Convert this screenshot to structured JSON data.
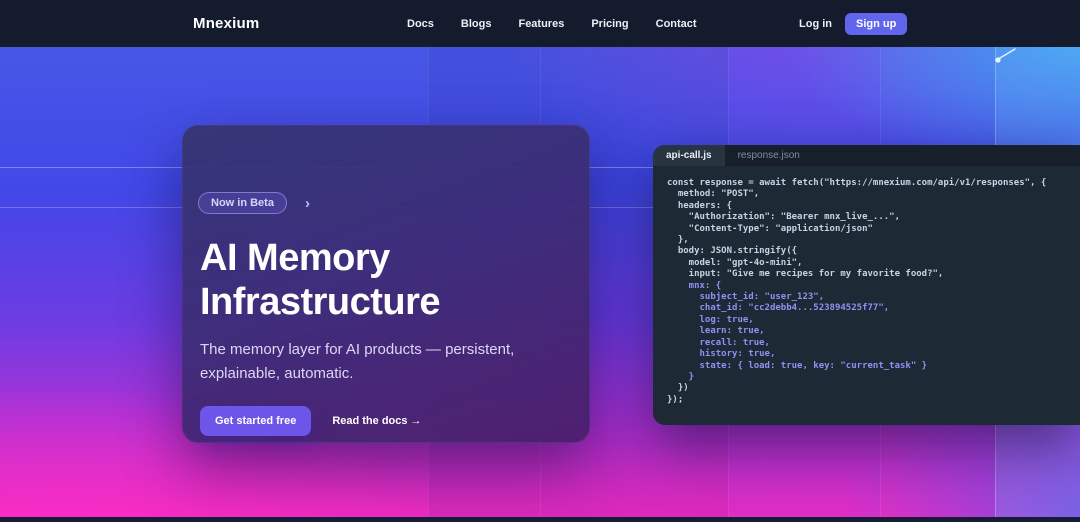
{
  "navbar": {
    "logo": "Mnexium",
    "links": [
      {
        "label": "Docs"
      },
      {
        "label": "Blogs"
      },
      {
        "label": "Features"
      },
      {
        "label": "Pricing"
      },
      {
        "label": "Contact"
      }
    ],
    "login_label": "Log in",
    "signup_label": "Sign up"
  },
  "hero": {
    "badge_label": "Now in Beta",
    "badge_chevron": "›",
    "title": "AI Memory Infrastructure",
    "subtitle": "The memory layer for AI products — persistent, explainable, automatic.",
    "primary_cta": "Get started free",
    "secondary_cta": "Read the docs →"
  },
  "code_panel": {
    "tabs": [
      {
        "label": "api-call.js",
        "active": true
      },
      {
        "label": "response.json",
        "active": false
      }
    ],
    "lines": [
      {
        "text": "const response = await fetch(\"https://mnexium.com/api/v1/responses\", {",
        "tone": "default"
      },
      {
        "text": "  method: \"POST\",",
        "tone": "default"
      },
      {
        "text": "  headers: {",
        "tone": "default"
      },
      {
        "text": "    \"Authorization\": \"Bearer mnx_live_...\",",
        "tone": "default"
      },
      {
        "text": "    \"Content-Type\": \"application/json\"",
        "tone": "default"
      },
      {
        "text": "  },",
        "tone": "default"
      },
      {
        "text": "  body: JSON.stringify({",
        "tone": "default"
      },
      {
        "text": "    model: \"gpt-4o-mini\",",
        "tone": "default"
      },
      {
        "text": "    input: \"Give me recipes for my favorite food?\",",
        "tone": "default"
      },
      {
        "text": "    mnx: {",
        "tone": "accent"
      },
      {
        "text": "      subject_id: \"user_123\",",
        "tone": "accent"
      },
      {
        "text": "      chat_id: \"cc2debb4...523894525f77\",",
        "tone": "accent"
      },
      {
        "text": "      log: true,",
        "tone": "accent"
      },
      {
        "text": "      learn: true,",
        "tone": "accent"
      },
      {
        "text": "      recall: true,",
        "tone": "accent"
      },
      {
        "text": "      history: true,",
        "tone": "accent"
      },
      {
        "text": "      state: { load: true, key: \"current_task\" }",
        "tone": "accent"
      },
      {
        "text": "    }",
        "tone": "accent"
      },
      {
        "text": "  })",
        "tone": "default"
      },
      {
        "text": "});",
        "tone": "default"
      }
    ]
  },
  "colors": {
    "navbar_bg": "#131b2d",
    "signup_purple": "#6165ec",
    "cta_purple": "#6d55ea",
    "code_panel_bg": "#1e2936",
    "code_accent": "#8d93f2",
    "gradient_blue": "#4148e8",
    "gradient_violet": "#6c3ce2",
    "gradient_pink": "#ee2cbe",
    "gradient_lightblue": "#41aaf2"
  }
}
